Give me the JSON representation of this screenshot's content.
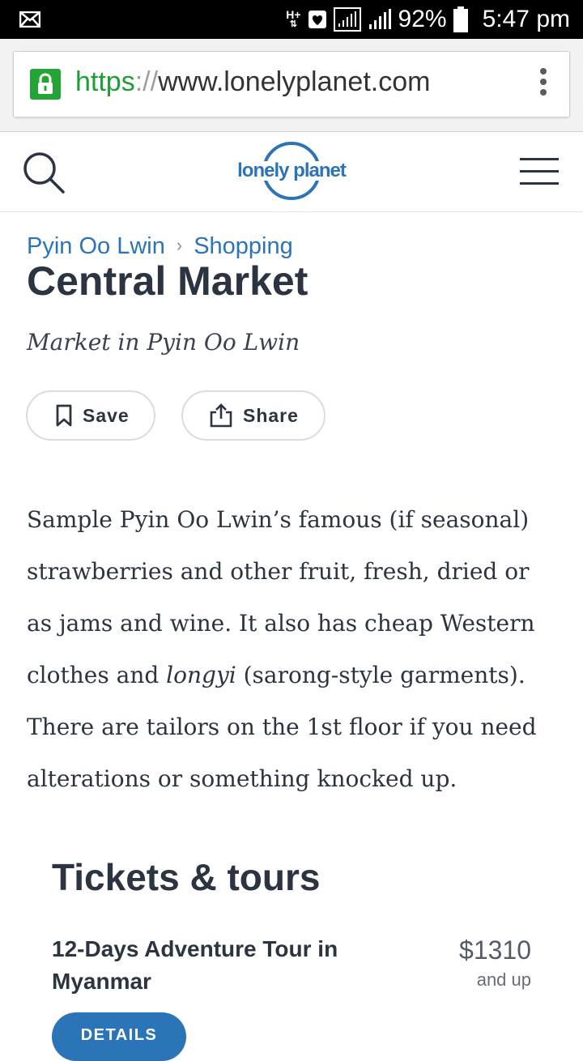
{
  "status_bar": {
    "network": "H+",
    "battery": "92%",
    "time": "5:47 pm"
  },
  "browser": {
    "url_scheme": "https",
    "url_sep": "://",
    "url_host": "www.lonelyplanet.com"
  },
  "header": {
    "logo_text": "lonely planet"
  },
  "breadcrumb": {
    "items": [
      "Pyin Oo Lwin",
      "Shopping"
    ],
    "separator": "›"
  },
  "page": {
    "title": "Central Market",
    "subtitle": "Market in Pyin Oo Lwin",
    "save_label": "Save",
    "share_label": "Share",
    "description": {
      "part1": "Sample Pyin Oo Lwin’s famous (if seasonal) strawberries and other fruit, fresh, dried or as jams and wine. It also has cheap Western clothes and ",
      "emphasis": "longyi",
      "part2": " (sarong-style garments). There are tailors on the 1st floor if you need alterations or something knocked up."
    }
  },
  "tickets": {
    "heading": "Tickets & tours",
    "items": [
      {
        "name": "12-Days Adventure Tour in Myanmar",
        "price": "$1310",
        "price_note": "and up",
        "button_label": "DETAILS"
      }
    ]
  },
  "colors": {
    "accent": "#2c74b8",
    "text": "#2b3440",
    "secure_green": "#23a536"
  }
}
